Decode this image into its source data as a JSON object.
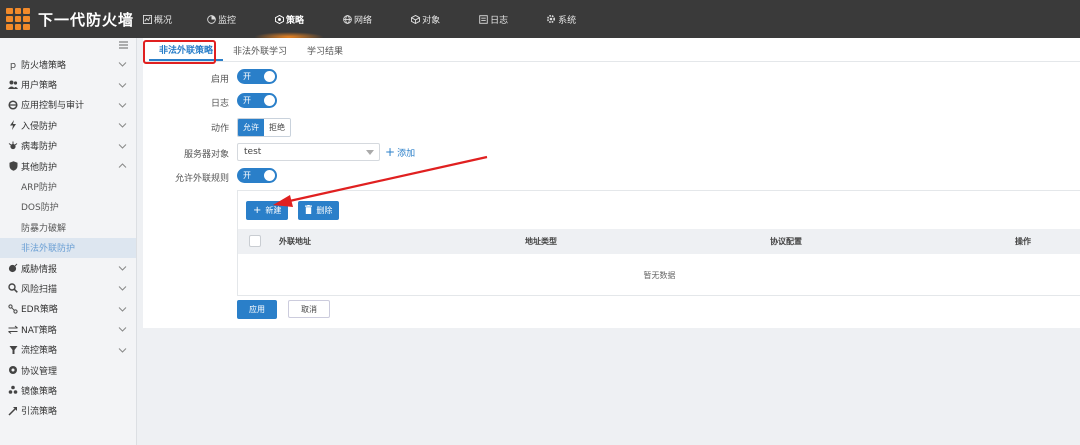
{
  "app": {
    "title": "下一代防火墙"
  },
  "topnav": [
    {
      "label": "概况",
      "icon": "overview-icon"
    },
    {
      "label": "监控",
      "icon": "monitor-icon"
    },
    {
      "label": "策略",
      "icon": "policy-icon",
      "active": true
    },
    {
      "label": "网络",
      "icon": "globe-icon"
    },
    {
      "label": "对象",
      "icon": "object-icon"
    },
    {
      "label": "日志",
      "icon": "log-icon"
    },
    {
      "label": "系统",
      "icon": "gear-icon"
    }
  ],
  "sidebar": {
    "items": [
      {
        "label": "防火墙策略",
        "icon": "firewall-icon"
      },
      {
        "label": "用户策略",
        "icon": "users-icon"
      },
      {
        "label": "应用控制与审计",
        "icon": "app-control-icon"
      },
      {
        "label": "入侵防护",
        "icon": "bolt-icon"
      },
      {
        "label": "病毒防护",
        "icon": "virus-icon"
      },
      {
        "label": "其他防护",
        "icon": "shield-icon",
        "expanded": true
      },
      {
        "label": "威胁情报",
        "icon": "threat-icon"
      },
      {
        "label": "风险扫描",
        "icon": "search-icon"
      },
      {
        "label": "EDR策略",
        "icon": "edr-icon"
      },
      {
        "label": "NAT策略",
        "icon": "swap-icon"
      },
      {
        "label": "流控策略",
        "icon": "filter-icon"
      },
      {
        "label": "协议管理",
        "icon": "protocol-icon"
      },
      {
        "label": "镜像策略",
        "icon": "mirror-icon"
      },
      {
        "label": "引流策略",
        "icon": "redirect-icon"
      }
    ],
    "sub_items": [
      "ARP防护",
      "DOS防护",
      "防暴力破解",
      "非法外联防护"
    ]
  },
  "tabs": [
    "非法外联策略",
    "非法外联学习",
    "学习结果"
  ],
  "form": {
    "enable_label": "启用",
    "log_label": "日志",
    "action_label": "动作",
    "server_label": "服务器对象",
    "allow_rule_label": "允许外联规则",
    "switch_on": "开",
    "action_allow": "允许",
    "action_deny": "拒绝",
    "server_value": "test",
    "add_label": "添加"
  },
  "rules": {
    "new_label": "新建",
    "delete_label": "删除",
    "columns": [
      "外联地址",
      "地址类型",
      "协议配置",
      "操作"
    ],
    "empty_text": "暂无数据"
  },
  "footer": {
    "apply_label": "应用",
    "cancel_label": "取消"
  },
  "colors": {
    "accent": "#2a7fc9",
    "highlight": "#e02020",
    "brand": "#f28a2a"
  }
}
